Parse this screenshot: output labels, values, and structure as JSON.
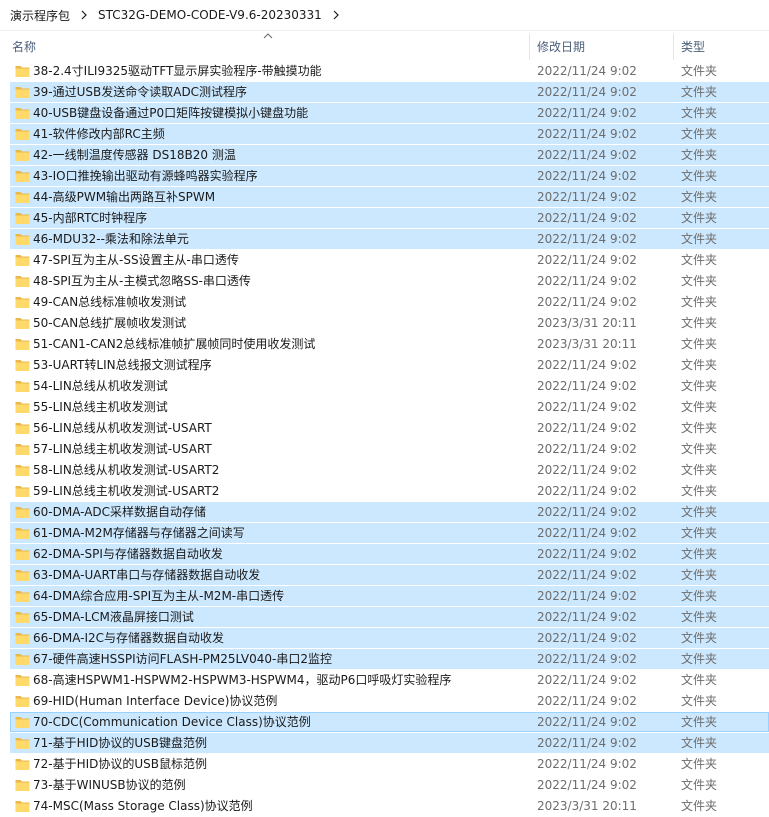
{
  "breadcrumb": {
    "items": [
      "演示程序包",
      "STC32G-DEMO-CODE-V9.6-20230331"
    ],
    "separator_icon": "chevron-right-icon"
  },
  "columns": {
    "name": "名称",
    "date": "修改日期",
    "type": "类型",
    "sort_icon": "sort-up-icon"
  },
  "colors": {
    "selection": "#cce8ff",
    "focus_border": "#99d1ff",
    "folder": "#ffd96a",
    "folder_dark": "#e8b94a",
    "header_text": "#4c607a"
  },
  "rows": [
    {
      "name": "38-2.4寸ILI9325驱动TFT显示屏实验程序-带触摸功能",
      "date": "2022/11/24 9:02",
      "type": "文件夹",
      "selected": false
    },
    {
      "name": "39-通过USB发送命令读取ADC测试程序",
      "date": "2022/11/24 9:02",
      "type": "文件夹",
      "selected": true
    },
    {
      "name": "40-USB键盘设备通过P0口矩阵按键模拟小键盘功能",
      "date": "2022/11/24 9:02",
      "type": "文件夹",
      "selected": true
    },
    {
      "name": "41-软件修改内部RC主频",
      "date": "2022/11/24 9:02",
      "type": "文件夹",
      "selected": true
    },
    {
      "name": "42-一线制温度传感器 DS18B20 测温",
      "date": "2022/11/24 9:02",
      "type": "文件夹",
      "selected": true
    },
    {
      "name": "43-IO口推挽输出驱动有源蜂鸣器实验程序",
      "date": "2022/11/24 9:02",
      "type": "文件夹",
      "selected": true
    },
    {
      "name": "44-高级PWM输出两路互补SPWM",
      "date": "2022/11/24 9:02",
      "type": "文件夹",
      "selected": true
    },
    {
      "name": "45-内部RTC时钟程序",
      "date": "2022/11/24 9:02",
      "type": "文件夹",
      "selected": true
    },
    {
      "name": "46-MDU32--乘法和除法单元",
      "date": "2022/11/24 9:02",
      "type": "文件夹",
      "selected": true
    },
    {
      "name": "47-SPI互为主从-SS设置主从-串口透传",
      "date": "2022/11/24 9:02",
      "type": "文件夹",
      "selected": false
    },
    {
      "name": "48-SPI互为主从-主模式忽略SS-串口透传",
      "date": "2022/11/24 9:02",
      "type": "文件夹",
      "selected": false
    },
    {
      "name": "49-CAN总线标准帧收发测试",
      "date": "2022/11/24 9:02",
      "type": "文件夹",
      "selected": false
    },
    {
      "name": "50-CAN总线扩展帧收发测试",
      "date": "2023/3/31 20:11",
      "type": "文件夹",
      "selected": false
    },
    {
      "name": "51-CAN1-CAN2总线标准帧扩展帧同时使用收发测试",
      "date": "2023/3/31 20:11",
      "type": "文件夹",
      "selected": false
    },
    {
      "name": "53-UART转LIN总线报文测试程序",
      "date": "2022/11/24 9:02",
      "type": "文件夹",
      "selected": false
    },
    {
      "name": "54-LIN总线从机收发测试",
      "date": "2022/11/24 9:02",
      "type": "文件夹",
      "selected": false
    },
    {
      "name": "55-LIN总线主机收发测试",
      "date": "2022/11/24 9:02",
      "type": "文件夹",
      "selected": false
    },
    {
      "name": "56-LIN总线从机收发测试-USART",
      "date": "2022/11/24 9:02",
      "type": "文件夹",
      "selected": false
    },
    {
      "name": "57-LIN总线主机收发测试-USART",
      "date": "2022/11/24 9:02",
      "type": "文件夹",
      "selected": false
    },
    {
      "name": "58-LIN总线从机收发测试-USART2",
      "date": "2022/11/24 9:02",
      "type": "文件夹",
      "selected": false
    },
    {
      "name": "59-LIN总线主机收发测试-USART2",
      "date": "2022/11/24 9:02",
      "type": "文件夹",
      "selected": false
    },
    {
      "name": "60-DMA-ADC采样数据自动存储",
      "date": "2022/11/24 9:02",
      "type": "文件夹",
      "selected": true
    },
    {
      "name": "61-DMA-M2M存储器与存储器之间读写",
      "date": "2022/11/24 9:02",
      "type": "文件夹",
      "selected": true
    },
    {
      "name": "62-DMA-SPI与存储器数据自动收发",
      "date": "2022/11/24 9:02",
      "type": "文件夹",
      "selected": true
    },
    {
      "name": "63-DMA-UART串口与存储器数据自动收发",
      "date": "2022/11/24 9:02",
      "type": "文件夹",
      "selected": true
    },
    {
      "name": "64-DMA综合应用-SPI互为主从-M2M-串口透传",
      "date": "2022/11/24 9:02",
      "type": "文件夹",
      "selected": true
    },
    {
      "name": "65-DMA-LCM液晶屏接口测试",
      "date": "2022/11/24 9:02",
      "type": "文件夹",
      "selected": true
    },
    {
      "name": "66-DMA-I2C与存储器数据自动收发",
      "date": "2022/11/24 9:02",
      "type": "文件夹",
      "selected": true
    },
    {
      "name": "67-硬件高速HSSPI访问FLASH-PM25LV040-串口2监控",
      "date": "2022/11/24 9:02",
      "type": "文件夹",
      "selected": true
    },
    {
      "name": "68-高速HSPWM1-HSPWM2-HSPWM3-HSPWM4，驱动P6口呼吸灯实验程序",
      "date": "2022/11/24 9:02",
      "type": "文件夹",
      "selected": false
    },
    {
      "name": "69-HID(Human Interface Device)协议范例",
      "date": "2022/11/24 9:02",
      "type": "文件夹",
      "selected": false
    },
    {
      "name": "70-CDC(Communication Device Class)协议范例",
      "date": "2022/11/24 9:02",
      "type": "文件夹",
      "selected": true,
      "focused": true
    },
    {
      "name": "71-基于HID协议的USB键盘范例",
      "date": "2022/11/24 9:02",
      "type": "文件夹",
      "selected": true
    },
    {
      "name": "72-基于HID协议的USB鼠标范例",
      "date": "2022/11/24 9:02",
      "type": "文件夹",
      "selected": false
    },
    {
      "name": "73-基于WINUSB协议的范例",
      "date": "2022/11/24 9:02",
      "type": "文件夹",
      "selected": false
    },
    {
      "name": "74-MSC(Mass Storage Class)协议范例",
      "date": "2023/3/31 20:11",
      "type": "文件夹",
      "selected": false
    }
  ]
}
